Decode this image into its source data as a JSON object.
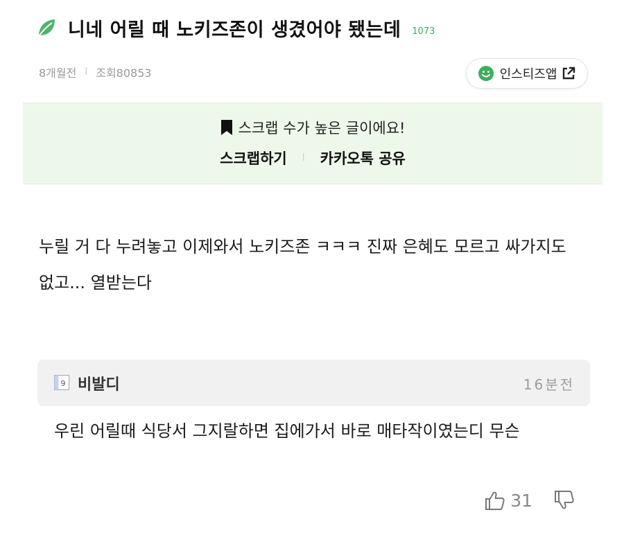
{
  "post": {
    "title": "니네 어릴 때 노키즈존이 생겼어야 됐는데",
    "comment_count": "1073",
    "time_ago": "8개월전",
    "separator": "l",
    "views": "조회80853",
    "app_button_label": "인스티즈앱",
    "body": "누릴 거 다 누려놓고 이제와서 노키즈존 ㅋㅋㅋ 진짜 은혜도 모르고 싸가지도 없고... 열받는다"
  },
  "scrap_banner": {
    "message": "스크랩 수가 높은 글이에요!",
    "scrap_label": "스크랩하기",
    "separator": "l",
    "share_label": "카카오톡 공유"
  },
  "comment": {
    "author": "비발디",
    "time": "16분전",
    "body": "우린 어릴때 식당서 그지랄하면 집에가서 바로 매타작이였는디 무슨",
    "likes": "31"
  },
  "colors": {
    "accent_green": "#3cae5d",
    "banner_bg": "#eef8ea",
    "comment_bg": "#f1f1f1"
  },
  "icons": {
    "title": "leaf-icon",
    "app_button_left": "smile-icon",
    "app_button_right": "external-link-icon",
    "banner": "bookmark-icon",
    "comment_avatar": "level-badge-icon",
    "like": "thumbs-up-icon",
    "dislike": "thumbs-down-icon"
  }
}
